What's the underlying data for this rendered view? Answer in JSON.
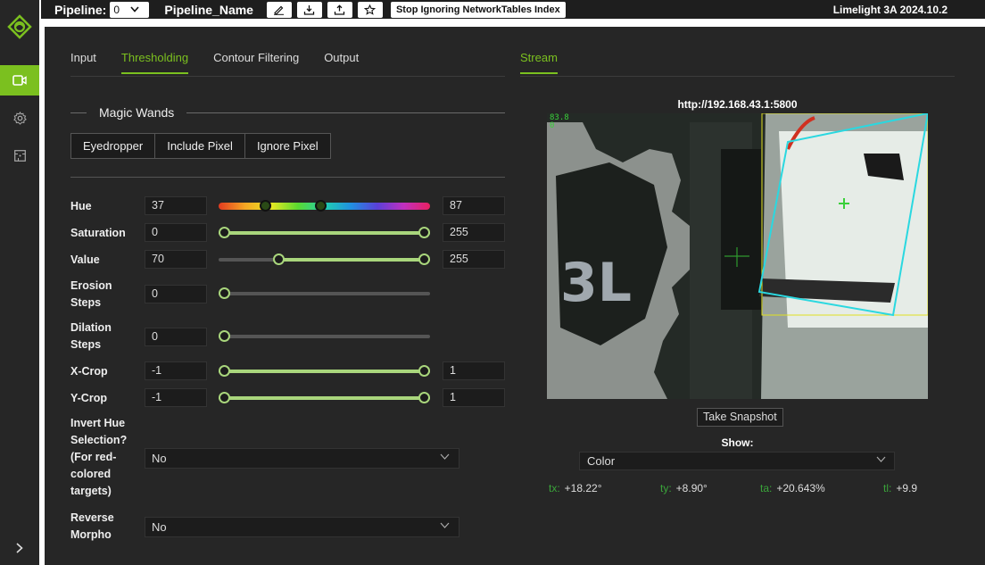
{
  "topbar": {
    "pipeline_label": "Pipeline:",
    "pipeline_index": "0",
    "pipeline_name": "Pipeline_Name",
    "ignore_nt_label": "Stop Ignoring NetworkTables Index",
    "version": "Limelight 3A 2024.10.2"
  },
  "sidebar": {
    "items": [
      {
        "icon": "limelight-logo-icon"
      },
      {
        "icon": "camera-icon",
        "active": true
      },
      {
        "icon": "gear-icon"
      },
      {
        "icon": "grid-icon"
      }
    ],
    "expand_icon": "chevron-right-icon"
  },
  "tabs": [
    {
      "label": "Input"
    },
    {
      "label": "Thresholding",
      "active": true
    },
    {
      "label": "Contour Filtering"
    },
    {
      "label": "Output"
    }
  ],
  "stream_tab": "Stream",
  "magic_wands": {
    "title": "Magic Wands",
    "buttons": [
      "Eyedropper",
      "Include Pixel",
      "Ignore Pixel"
    ]
  },
  "thresholds": {
    "hue": {
      "label": "Hue",
      "min": "37",
      "max": "87",
      "range": [
        0,
        180
      ],
      "values": [
        37,
        87
      ]
    },
    "saturation": {
      "label": "Saturation",
      "min": "0",
      "max": "255",
      "range": [
        0,
        255
      ],
      "values": [
        0,
        255
      ]
    },
    "value": {
      "label": "Value",
      "min": "70",
      "max": "255",
      "range": [
        0,
        255
      ],
      "values": [
        70,
        255
      ]
    },
    "erosion": {
      "label_line1": "Erosion",
      "label_line2": "Steps",
      "value": "0",
      "range": [
        0,
        10
      ],
      "level": 0
    },
    "dilation": {
      "label_line1": "Dilation",
      "label_line2": "Steps",
      "value": "0",
      "range": [
        0,
        10
      ],
      "level": 0
    },
    "xcrop": {
      "label": "X-Crop",
      "min": "-1",
      "max": "1",
      "range": [
        -1,
        1
      ],
      "values": [
        -1,
        1
      ]
    },
    "ycrop": {
      "label": "Y-Crop",
      "min": "-1",
      "max": "1",
      "range": [
        -1,
        1
      ],
      "values": [
        -1,
        1
      ]
    }
  },
  "invert_hue": {
    "lines": [
      "Invert Hue",
      "Selection?",
      "(For red-",
      "colored",
      "targets)"
    ],
    "value": "No"
  },
  "reverse_morpho": {
    "lines": [
      "Reverse",
      "Morpho"
    ],
    "value": "No"
  },
  "stream": {
    "url": "http://192.168.43.1:5800",
    "overlay_line1": "83.8",
    "overlay_line2": "0",
    "snapshot_label": "Take Snapshot",
    "show_label": "Show:",
    "show_value": "Color",
    "stats": [
      {
        "key": "tx:",
        "value": "+18.22°"
      },
      {
        "key": "ty:",
        "value": "+8.90°"
      },
      {
        "key": "ta:",
        "value": "+20.643%"
      },
      {
        "key": "tl:",
        "value": "+9.9"
      }
    ]
  },
  "colors": {
    "accent": "#7bc01f",
    "panel": "#262626",
    "target_box": "#2ad8e0",
    "bounding_box": "#e0e020",
    "crosshair": "#3ad03a"
  }
}
